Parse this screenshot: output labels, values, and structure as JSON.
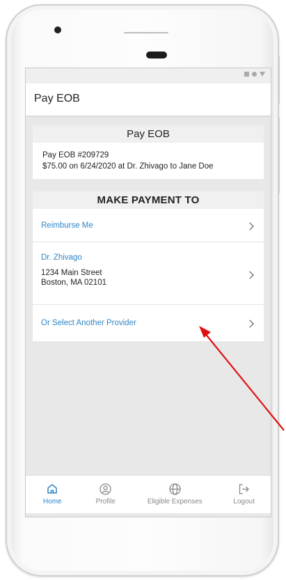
{
  "appbar": {
    "title": "Pay EOB"
  },
  "eob_section": {
    "header": "Pay EOB",
    "line1": "Pay EOB #209729",
    "line2": "$75.00 on 6/24/2020 at Dr. Zhivago to Jane Doe"
  },
  "payment_section": {
    "header": "MAKE PAYMENT TO",
    "reimburse_label": "Reimburse Me",
    "provider": {
      "name": "Dr. Zhivago",
      "street": "1234 Main Street",
      "city": "Boston, MA 02101"
    },
    "other_provider_label": "Or Select Another Provider"
  },
  "bottom_nav": {
    "home": "Home",
    "profile": "Profile",
    "eligible": "Eligible Expenses",
    "logout": "Logout"
  },
  "icons": {
    "home": "home-icon",
    "profile": "profile-icon",
    "eligible": "globe-icon",
    "logout": "logout-icon",
    "chevron": "chevron-right-icon"
  },
  "colors": {
    "accent": "#2f86c6",
    "annotation_arrow": "#e01010",
    "nav_inactive": "#888888"
  }
}
